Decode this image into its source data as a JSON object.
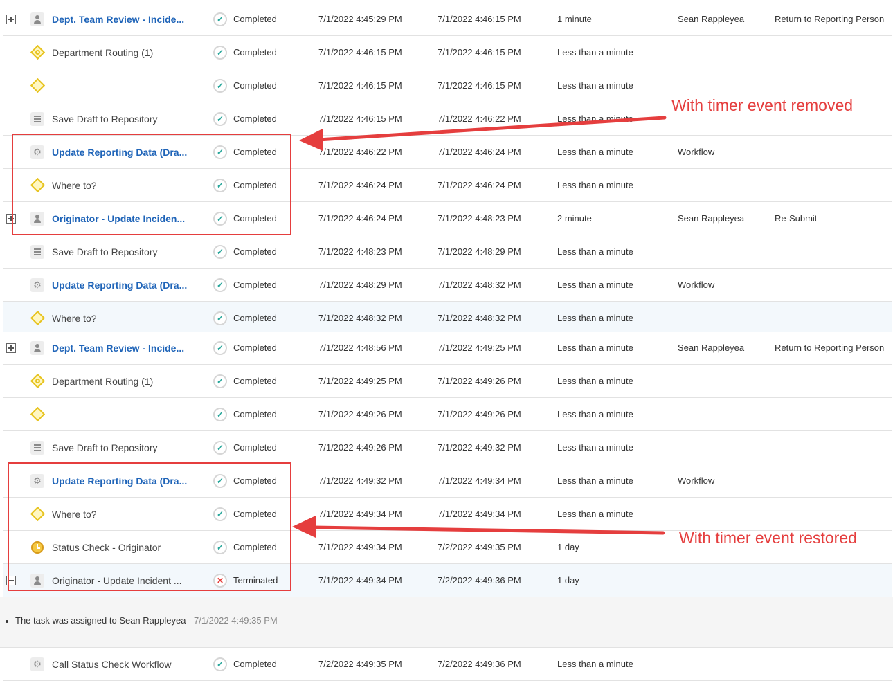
{
  "rows": [
    {
      "expand": "plus",
      "icon": "user-task-icon",
      "name": "Dept. Team Review - Incide...",
      "link": true,
      "status_icon": "check",
      "status": "Completed",
      "start": "7/1/2022 4:45:29 PM",
      "end": "7/1/2022 4:46:15 PM",
      "duration": "1 minute",
      "assignee": "Sean Rappleyea",
      "action": "Return to Reporting Person"
    },
    {
      "expand": "",
      "icon": "routing-diamond-icon",
      "name": "Department Routing (1)",
      "link": false,
      "status_icon": "check",
      "status": "Completed",
      "start": "7/1/2022 4:46:15 PM",
      "end": "7/1/2022 4:46:15 PM",
      "duration": "Less than a minute",
      "assignee": "",
      "action": ""
    },
    {
      "expand": "",
      "icon": "gateway-diamond-icon",
      "name": "",
      "link": false,
      "status_icon": "check",
      "status": "Completed",
      "start": "7/1/2022 4:46:15 PM",
      "end": "7/1/2022 4:46:15 PM",
      "duration": "Less than a minute",
      "assignee": "",
      "action": ""
    },
    {
      "expand": "",
      "icon": "document-task-icon",
      "name": "Save Draft to Repository",
      "link": false,
      "status_icon": "check",
      "status": "Completed",
      "start": "7/1/2022 4:46:15 PM",
      "end": "7/1/2022 4:46:22 PM",
      "duration": "Less than a minute",
      "assignee": "",
      "action": ""
    },
    {
      "expand": "",
      "icon": "service-task-gear-icon",
      "name": "Update Reporting Data (Dra...",
      "link": true,
      "status_icon": "check",
      "status": "Completed",
      "start": "7/1/2022 4:46:22 PM",
      "end": "7/1/2022 4:46:24 PM",
      "duration": "Less than a minute",
      "assignee": "Workflow",
      "action": ""
    },
    {
      "expand": "",
      "icon": "gateway-diamond-icon",
      "name": "Where to?",
      "link": false,
      "status_icon": "check",
      "status": "Completed",
      "start": "7/1/2022 4:46:24 PM",
      "end": "7/1/2022 4:46:24 PM",
      "duration": "Less than a minute",
      "assignee": "",
      "action": ""
    },
    {
      "expand": "plus",
      "icon": "user-task-icon",
      "name": "Originator - Update Inciden...",
      "link": true,
      "status_icon": "check",
      "status": "Completed",
      "start": "7/1/2022 4:46:24 PM",
      "end": "7/1/2022 4:48:23 PM",
      "duration": "2 minute",
      "assignee": "Sean Rappleyea",
      "action": "Re-Submit"
    },
    {
      "expand": "",
      "icon": "document-task-icon",
      "name": "Save Draft to Repository",
      "link": false,
      "status_icon": "check",
      "status": "Completed",
      "start": "7/1/2022 4:48:23 PM",
      "end": "7/1/2022 4:48:29 PM",
      "duration": "Less than a minute",
      "assignee": "",
      "action": ""
    },
    {
      "expand": "",
      "icon": "service-task-gear-icon",
      "name": "Update Reporting Data (Dra...",
      "link": true,
      "status_icon": "check",
      "status": "Completed",
      "start": "7/1/2022 4:48:29 PM",
      "end": "7/1/2022 4:48:32 PM",
      "duration": "Less than a minute",
      "assignee": "Workflow",
      "action": ""
    },
    {
      "expand": "",
      "icon": "gateway-diamond-icon",
      "name": "Where to?",
      "link": false,
      "status_icon": "check",
      "status": "Completed",
      "start": "7/1/2022 4:48:32 PM",
      "end": "7/1/2022 4:48:32 PM",
      "duration": "Less than a minute",
      "assignee": "",
      "action": "",
      "shaded": true
    },
    {
      "expand": "plus",
      "icon": "user-task-icon",
      "name": "Dept. Team Review - Incide...",
      "link": true,
      "status_icon": "check",
      "status": "Completed",
      "start": "7/1/2022 4:48:56 PM",
      "end": "7/1/2022 4:49:25 PM",
      "duration": "Less than a minute",
      "assignee": "Sean Rappleyea",
      "action": "Return to Reporting Person"
    },
    {
      "expand": "",
      "icon": "routing-diamond-icon",
      "name": "Department Routing (1)",
      "link": false,
      "status_icon": "check",
      "status": "Completed",
      "start": "7/1/2022 4:49:25 PM",
      "end": "7/1/2022 4:49:26 PM",
      "duration": "Less than a minute",
      "assignee": "",
      "action": ""
    },
    {
      "expand": "",
      "icon": "gateway-diamond-icon",
      "name": "",
      "link": false,
      "status_icon": "check",
      "status": "Completed",
      "start": "7/1/2022 4:49:26 PM",
      "end": "7/1/2022 4:49:26 PM",
      "duration": "Less than a minute",
      "assignee": "",
      "action": ""
    },
    {
      "expand": "",
      "icon": "document-task-icon",
      "name": "Save Draft to Repository",
      "link": false,
      "status_icon": "check",
      "status": "Completed",
      "start": "7/1/2022 4:49:26 PM",
      "end": "7/1/2022 4:49:32 PM",
      "duration": "Less than a minute",
      "assignee": "",
      "action": ""
    },
    {
      "expand": "",
      "icon": "service-task-gear-icon",
      "name": "Update Reporting Data (Dra...",
      "link": true,
      "status_icon": "check",
      "status": "Completed",
      "start": "7/1/2022 4:49:32 PM",
      "end": "7/1/2022 4:49:34 PM",
      "duration": "Less than a minute",
      "assignee": "Workflow",
      "action": ""
    },
    {
      "expand": "",
      "icon": "gateway-diamond-icon",
      "name": "Where to?",
      "link": false,
      "status_icon": "check",
      "status": "Completed",
      "start": "7/1/2022 4:49:34 PM",
      "end": "7/1/2022 4:49:34 PM",
      "duration": "Less than a minute",
      "assignee": "",
      "action": ""
    },
    {
      "expand": "",
      "icon": "timer-clock-icon",
      "name": "Status Check - Originator",
      "link": false,
      "status_icon": "check",
      "status": "Completed",
      "start": "7/1/2022 4:49:34 PM",
      "end": "7/2/2022 4:49:35 PM",
      "duration": "1 day",
      "assignee": "",
      "action": ""
    },
    {
      "expand": "minus",
      "icon": "user-task-icon",
      "name": "Originator - Update Incident ...",
      "link": false,
      "status_icon": "cross",
      "status": "Terminated",
      "start": "7/1/2022 4:49:34 PM",
      "end": "7/2/2022 4:49:36 PM",
      "duration": "1 day",
      "assignee": "",
      "action": "",
      "shaded": true
    }
  ],
  "detail": {
    "message": "The task was assigned to Sean Rappleyea",
    "separator": " - ",
    "timestamp": "7/1/2022 4:49:35 PM"
  },
  "last_row": {
    "expand": "",
    "icon": "service-task-gear-icon",
    "name": "Call Status Check Workflow",
    "link": false,
    "status_icon": "check",
    "status": "Completed",
    "start": "7/2/2022 4:49:35 PM",
    "end": "7/2/2022 4:49:36 PM",
    "duration": "Less than a minute",
    "assignee": "",
    "action": ""
  },
  "annotations": {
    "top_label": "With timer event removed",
    "bottom_label": "With timer event restored",
    "color": "#e53e3e"
  }
}
